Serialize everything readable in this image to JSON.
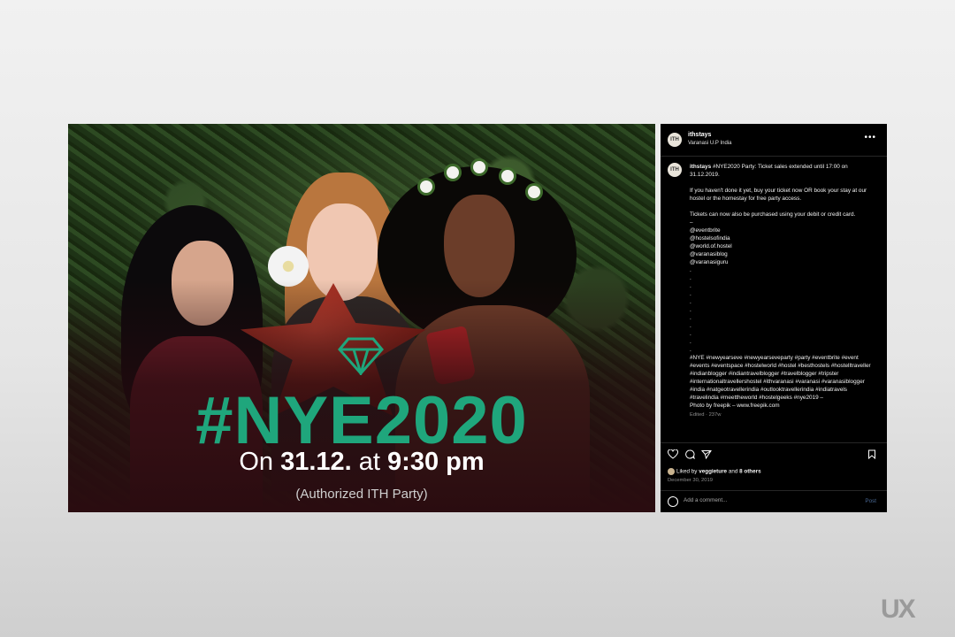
{
  "image": {
    "headline": "#NYE2020",
    "on_label": "On",
    "date": "31.12.",
    "at_label": "at",
    "time": "9:30 pm",
    "note": "(Authorized ITH Party)",
    "headline_color": "#1fa67c"
  },
  "post": {
    "avatar_text": "ITH",
    "username": "ithstays",
    "location": "Varanasi U.P India",
    "more_icon": "more-horizontal-icon",
    "caption": {
      "author": "ithstays",
      "lines": [
        "#NYE2020 Party: Ticket sales extended until 17:00 on 31.12.2019.",
        "",
        "If you haven't done it yet, buy your ticket now OR book your stay at our hostel or the homestay for free party access.",
        "",
        "Tickets can now also be purchased using your debit or credit card.",
        "–",
        "@eventbrite",
        "@hostelsofindia",
        "@world.of.hostel",
        "@varanasiblog",
        "@varanasiguru",
        ".",
        ".",
        ".",
        ".",
        ".",
        ".",
        ".",
        ".",
        ".",
        ".",
        ".",
        "#NYE #newyearseve #newyearseveparty #party #eventbrite #event #events #eventspace #hostelworld #hostel #besthostels #hostelltraveller #indianblogger #indiantravelblogger #travelblogger #tripster #internationaltravellershostel #ithvaranasi #varanasi #varanasiblogger #india #natgeotravellerindia #outlooktravellerindia #indiatravels #travelindia #meettheworld #hostelgeeks #nye2019 –",
        "Photo by freepik – www.freepik.com"
      ],
      "edited": "Edited · 237w"
    },
    "likes": {
      "prefix": "Liked by",
      "user": "veggieture",
      "and": "and",
      "others": "8 others"
    },
    "date": "December 30, 2019",
    "comment_placeholder": "Add a comment...",
    "post_label": "Post",
    "post_color": "#4a6a95"
  },
  "watermark": "UX"
}
